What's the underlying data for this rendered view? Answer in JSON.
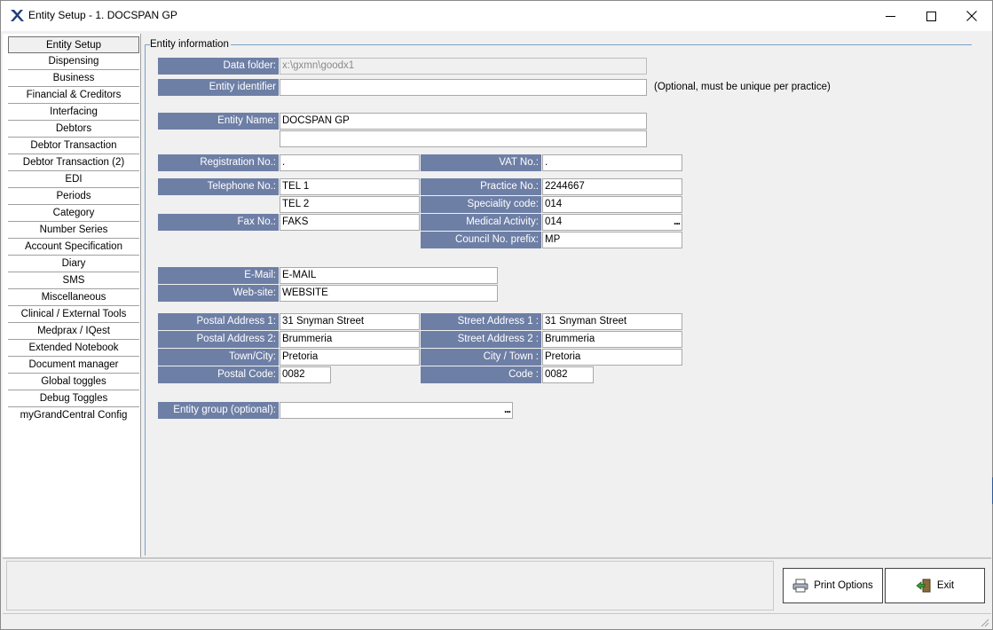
{
  "window": {
    "title": "Entity Setup - 1. DOCSPAN GP"
  },
  "sidebar": {
    "items": [
      "Entity Setup",
      "Dispensing",
      "Business",
      "Financial & Creditors",
      "Interfacing",
      "Debtors",
      "Debtor Transaction",
      "Debtor Transaction (2)",
      "EDI",
      "Periods",
      "Category",
      "Number Series",
      "Account Specification",
      "Diary",
      "SMS",
      "Miscellaneous",
      "Clinical / External Tools",
      "Medprax / IQest",
      "Extended Notebook",
      "Document manager",
      "Global toggles",
      "Debug Toggles",
      "myGrandCentral Config"
    ],
    "active": "Entity Setup"
  },
  "form": {
    "group_title": "Entity information",
    "data_folder_label": "Data folder:",
    "data_folder_value": "x:\\gxmn\\goodx1",
    "entity_identifier_label": "Entity identifier",
    "entity_identifier_value": "",
    "entity_identifier_note": "(Optional, must be unique per practice)",
    "entity_name_label": "Entity Name:",
    "entity_name_value": "DOCSPAN GP",
    "entity_name_value2": "",
    "registration_label": "Registration No.:",
    "registration_value": ".",
    "vat_label": "VAT No.:",
    "vat_value": ".",
    "telephone_label": "Telephone No.:",
    "telephone_value1": "TEL 1",
    "telephone_value2": "TEL 2",
    "practice_no_label": "Practice No.:",
    "practice_no_value": "2244667",
    "speciality_label": "Speciality code:",
    "speciality_value": "014",
    "fax_label": "Fax No.:",
    "fax_value": "FAKS",
    "medical_activity_label": "Medical Activity:",
    "medical_activity_value": "014",
    "council_label": "Council No. prefix:",
    "council_value": "MP",
    "email_label": "E-Mail:",
    "email_value": "E-MAIL",
    "website_label": "Web-site:",
    "website_value": "WEBSITE",
    "postal1_label": "Postal Address 1:",
    "postal1_value": "31 Snyman Street",
    "postal2_label": "Postal Address 2:",
    "postal2_value": "Brummeria",
    "town_city_label": "Town/City:",
    "town_city_value": "Pretoria",
    "postal_code_label": "Postal Code:",
    "postal_code_value": "0082",
    "street1_label": "Street Address 1 :",
    "street1_value": "31 Snyman Street",
    "street2_label": "Street Address 2 :",
    "street2_value": "Brummeria",
    "city_town_label": "City / Town :",
    "city_town_value": "Pretoria",
    "code_label": "Code :",
    "code_value": "0082",
    "entity_group_label": "Entity group (optional):",
    "entity_group_value": "",
    "ellipsis": "..."
  },
  "buttons": {
    "print_options": "Print Options",
    "exit": "Exit"
  }
}
